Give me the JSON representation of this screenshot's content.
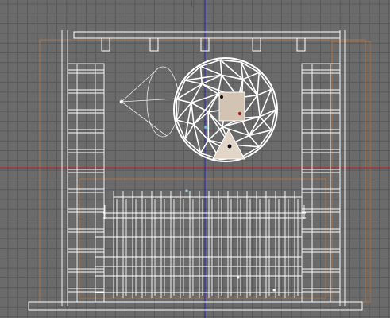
{
  "viewport": {
    "view": "Top",
    "shading": "wireframe",
    "background_color": "#6b6b6b",
    "grid_color": "#595959",
    "wire_color": "#ffffff",
    "axis_x_color": "#c01818",
    "axis_y_color": "#2020c0",
    "label_text": "|",
    "objects": [
      {
        "name": "frame-left"
      },
      {
        "name": "frame-right"
      },
      {
        "name": "top-beam"
      },
      {
        "name": "geodesic-dome"
      },
      {
        "name": "camera-cone"
      },
      {
        "name": "fence-grid"
      },
      {
        "name": "floor-plate"
      }
    ]
  }
}
